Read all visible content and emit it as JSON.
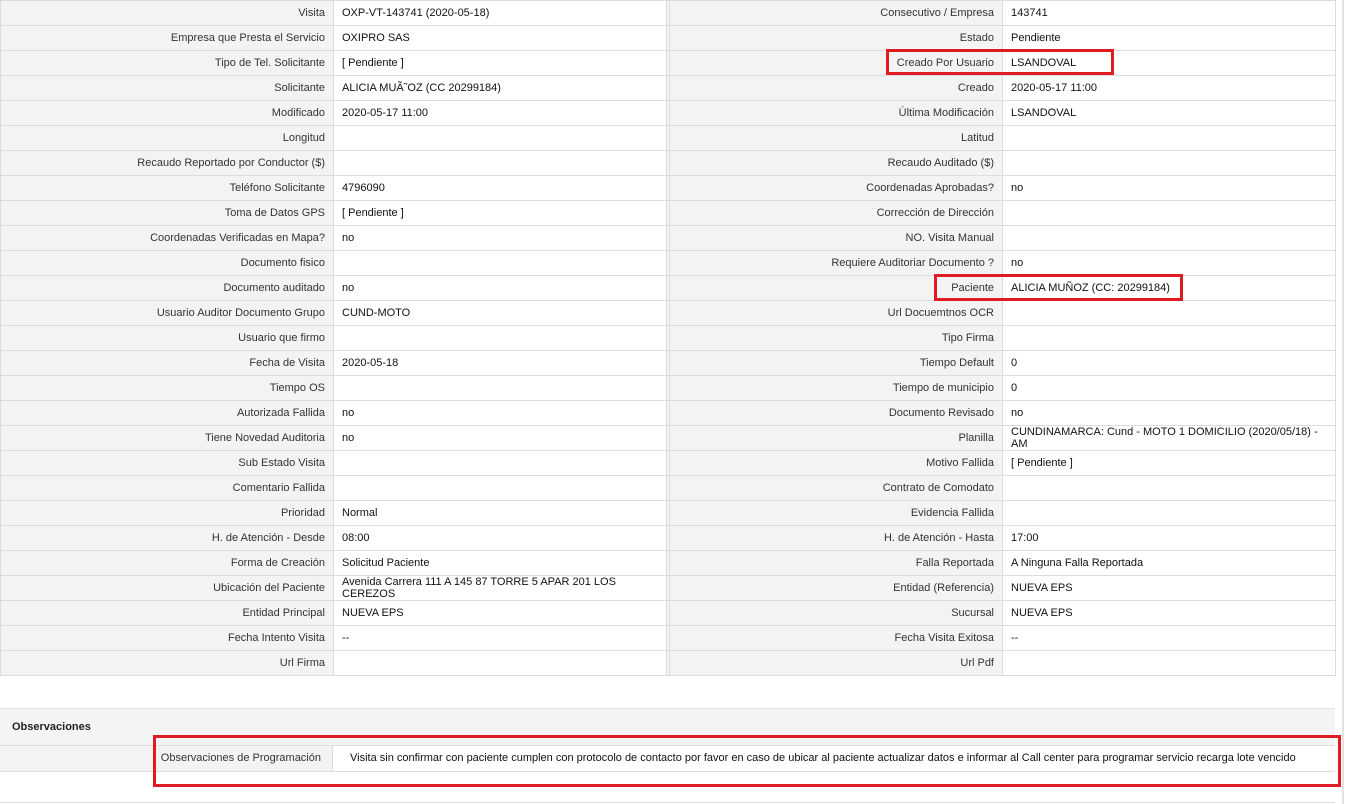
{
  "highlight_color": "#e11b22",
  "rows": [
    {
      "l1": "Visita",
      "v1": "OXP-VT-143741 (2020-05-18)",
      "l2": "Consecutivo / Empresa",
      "v2": "143741"
    },
    {
      "l1": "Empresa que Presta el Servicio",
      "v1": "OXIPRO SAS",
      "l2": "Estado",
      "v2": "Pendiente"
    },
    {
      "l1": "Tipo de Tel. Solicitante",
      "v1": "[ Pendiente ]",
      "l2": "Creado Por Usuario",
      "v2": "LSANDOVAL"
    },
    {
      "l1": "Solicitante",
      "v1": "ALICIA MUÃ˜OZ (CC 20299184)",
      "l2": "Creado",
      "v2": "2020-05-17 11:00"
    },
    {
      "l1": "Modificado",
      "v1": "2020-05-17 11:00",
      "l2": "Última Modificación",
      "v2": " LSANDOVAL"
    },
    {
      "l1": "Longitud",
      "v1": "",
      "l2": "Latitud",
      "v2": ""
    },
    {
      "l1": "Recaudo Reportado por Conductor ($)",
      "v1": "",
      "l2": "Recaudo Auditado ($)",
      "v2": ""
    },
    {
      "l1": "Teléfono Solicitante",
      "v1": "4796090",
      "l2": "Coordenadas Aprobadas?",
      "v2": " no"
    },
    {
      "l1": "Toma de Datos GPS",
      "v1": "[ Pendiente ]",
      "l2": "Corrección de Dirección",
      "v2": ""
    },
    {
      "l1": "Coordenadas Verificadas en Mapa?",
      "v1": " no",
      "l2": "NO. Visita Manual",
      "v2": ""
    },
    {
      "l1": "Documento fisico",
      "v1": "",
      "l2": "Requiere Auditoriar Documento ?",
      "v2": " no"
    },
    {
      "l1": "Documento auditado",
      "v1": " no",
      "l2": "Paciente",
      "v2": "ALICIA MUÑOZ (CC: 20299184)"
    },
    {
      "l1": "Usuario Auditor Documento Grupo",
      "v1": "CUND-MOTO",
      "l2": "Url Docuemtnos OCR",
      "v2": ""
    },
    {
      "l1": "Usuario que firmo",
      "v1": "",
      "l2": "Tipo Firma",
      "v2": ""
    },
    {
      "l1": "Fecha de Visita",
      "v1": " 2020-05-18",
      "l2": "Tiempo Default",
      "v2": "0"
    },
    {
      "l1": "Tiempo OS",
      "v1": "",
      "l2": "Tiempo de municipio",
      "v2": "0"
    },
    {
      "l1": "Autorizada Fallida",
      "v1": " no",
      "l2": "Documento Revisado",
      "v2": " no"
    },
    {
      "l1": "Tiene Novedad Auditoria",
      "v1": " no",
      "l2": "Planilla",
      "v2": "CUNDINAMARCA: Cund - MOTO 1 DOMICILIO (2020/05/18) - AM"
    },
    {
      "l1": "Sub Estado Visita",
      "v1": "",
      "l2": "Motivo Fallida",
      "v2": "[ Pendiente ]"
    },
    {
      "l1": "Comentario Fallida",
      "v1": "",
      "l2": "Contrato de Comodato",
      "v2": ""
    },
    {
      "l1": "Prioridad",
      "v1": "Normal",
      "l2": "Evidencia Fallida",
      "v2": ""
    },
    {
      "l1": "H. de Atención - Desde",
      "v1": "08:00",
      "l2": "H. de Atención - Hasta",
      "v2": "17:00"
    },
    {
      "l1": "Forma de Creación",
      "v1": "Solicitud Paciente",
      "l2": "Falla Reportada",
      "v2": "A Ninguna Falla Reportada"
    },
    {
      "l1": "Ubicación del Paciente",
      "v1": "Avenida Carrera 111 A 145 87 TORRE 5 APAR 201 LOS CEREZOS",
      "l2": "Entidad (Referencia)",
      "v2": "NUEVA EPS"
    },
    {
      "l1": "Entidad Principal",
      "v1": "NUEVA EPS",
      "l2": "Sucursal",
      "v2": "NUEVA EPS"
    },
    {
      "l1": "Fecha Intento Visita",
      "v1": " --",
      "l2": "Fecha Visita Exitosa",
      "v2": " --"
    },
    {
      "l1": "Url Firma",
      "v1": "",
      "l2": "Url Pdf",
      "v2": ""
    }
  ],
  "observaciones": {
    "section_title": "Observaciones",
    "label": "Observaciones de Programación",
    "value": "Visita sin confirmar con paciente cumplen con protocolo de contacto por favor en caso de ubicar al paciente actualizar datos e informar al Call center para programar servicio recarga lote vencido"
  }
}
